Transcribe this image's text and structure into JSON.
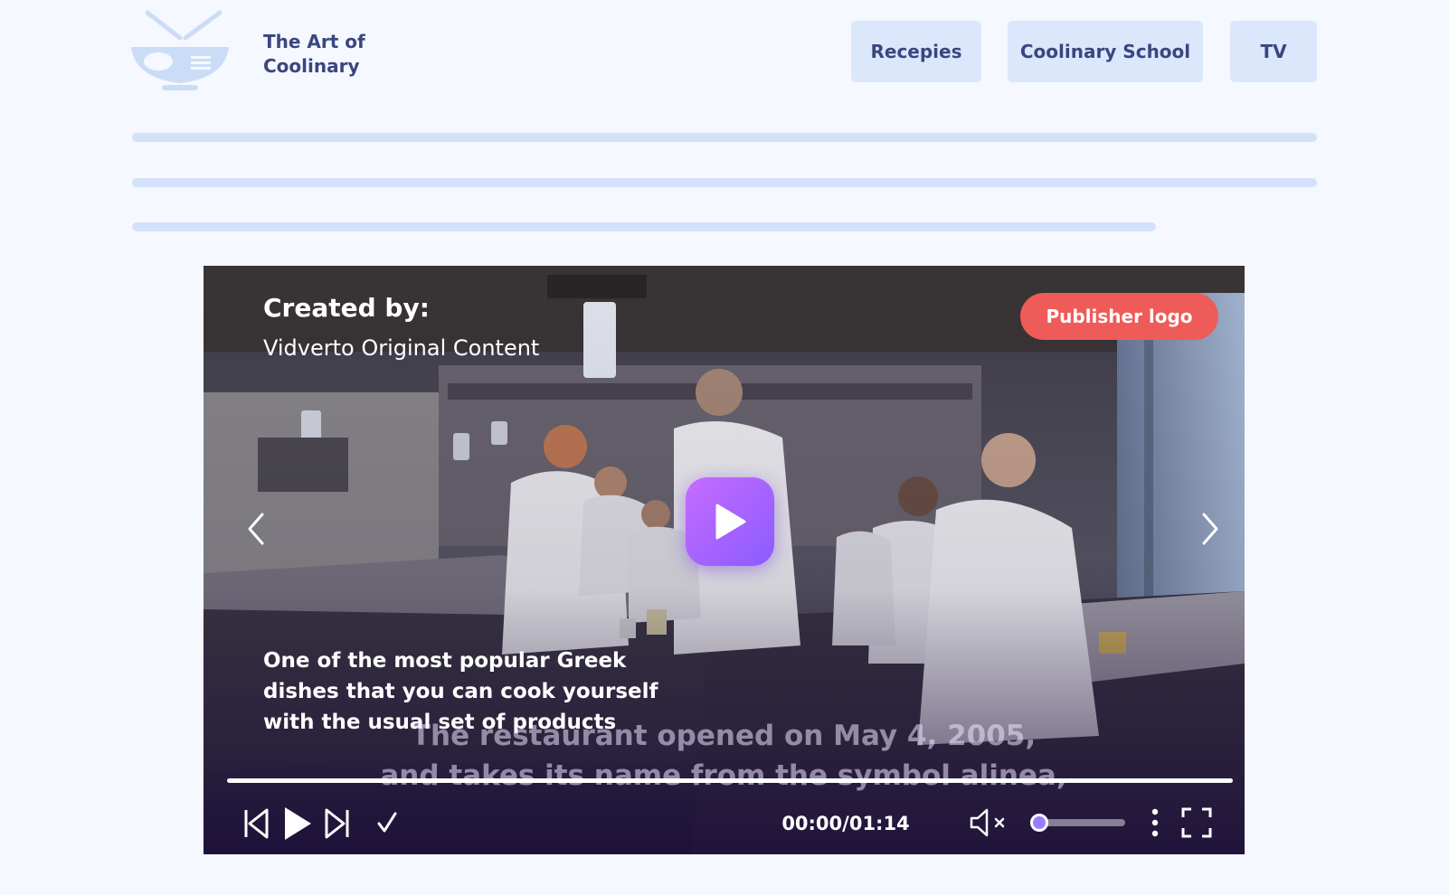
{
  "header": {
    "brand_line1": "The Art of",
    "brand_line2": "Coolinary",
    "nav": [
      {
        "label": "Recepies"
      },
      {
        "label": "Coolinary School"
      },
      {
        "label": "TV"
      }
    ]
  },
  "player": {
    "created_label": "Created by:",
    "created_value": "Vidverto Original Content",
    "publisher_label": "Publisher logo",
    "description": "One of the most popular Greek dishes that you can cook yourself with the usual set of products",
    "subtitle_line1": "The restaurant opened on May 4, 2005,",
    "subtitle_line2": "and takes its name from the symbol alinea,",
    "time": "00:00/01:14",
    "progress_fraction": 0,
    "volume_fraction": 0,
    "muted": true
  },
  "colors": {
    "page_bg": "#f5f8fe",
    "nav_bg": "#dbe7fb",
    "nav_text": "#3a4680",
    "publisher_bg": "#ee5b58",
    "play_gradient_start": "#c66bff",
    "play_gradient_end": "#8a5cff",
    "volume_knob": "#9b7bff"
  }
}
